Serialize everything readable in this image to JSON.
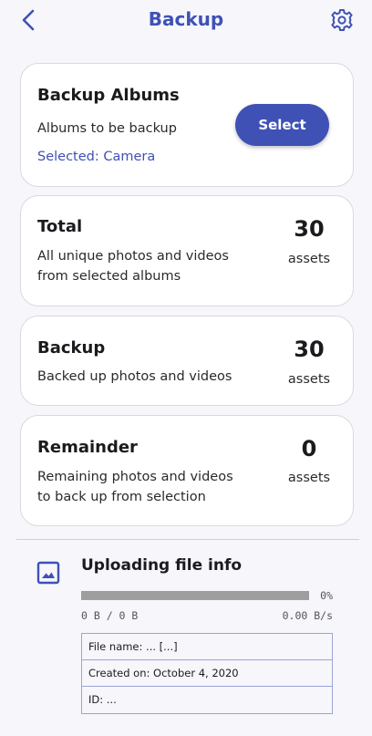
{
  "header": {
    "title": "Backup",
    "back_icon": "chevron-left-icon",
    "settings_icon": "gear-icon",
    "accent_color": "#3f51b5"
  },
  "albums_card": {
    "title": "Backup Albums",
    "description": "Albums to be backup",
    "selected": "Selected: Camera",
    "button_label": "Select"
  },
  "total_card": {
    "title": "Total",
    "description_line1": "All unique photos and videos",
    "description_line2": "from selected albums",
    "count": "30",
    "unit": "assets"
  },
  "backup_card": {
    "title": "Backup",
    "description": "Backed up photos and videos",
    "count": "30",
    "unit": "assets"
  },
  "remainder_card": {
    "title": "Remainder",
    "description_line1": "Remaining photos and videos",
    "description_line2": "to back up from selection",
    "count": "0",
    "unit": "assets"
  },
  "upload": {
    "icon": "image-icon",
    "title": "Uploading file info",
    "progress_fraction": 0.0,
    "progress_label": "0%",
    "bytes": "0 B / 0 B",
    "rate": "0.00 B/s",
    "file_name": "File name: ... [...]",
    "created_on": "Created on: October 4, 2020",
    "id": "ID: ..."
  }
}
